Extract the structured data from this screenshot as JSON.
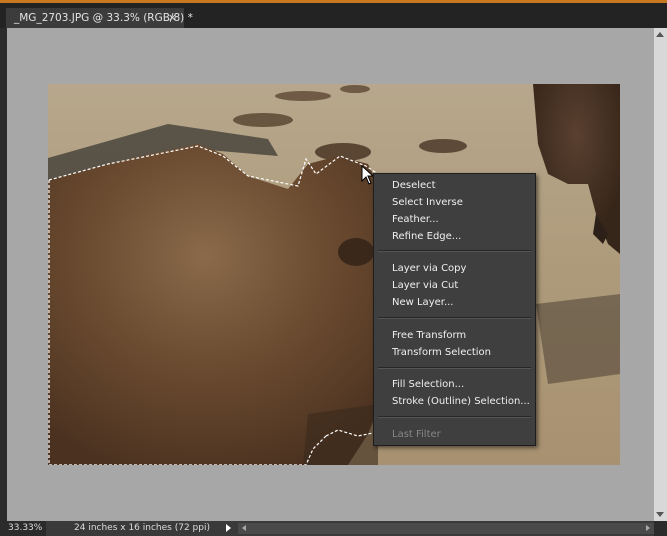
{
  "document_tab": {
    "title": "_MG_2703.JPG @ 33.3% (RGB/8) *",
    "close_glyph": "×"
  },
  "context_menu": {
    "groups": [
      [
        "Deselect",
        "Select Inverse",
        "Feather...",
        "Refine Edge..."
      ],
      [
        "Layer via Copy",
        "Layer via Cut",
        "New Layer..."
      ],
      [
        "Free Transform",
        "Transform Selection"
      ],
      [
        "Fill Selection...",
        "Stroke (Outline) Selection..."
      ],
      [
        "Last Filter"
      ]
    ],
    "disabled_items": [
      "Last Filter"
    ]
  },
  "status_bar": {
    "zoom": "33.33%",
    "document_size": "24 inches x 16 inches (72 ppi)"
  },
  "colors": {
    "accent": "#c8781e",
    "menu_bg": "#3f3f3f",
    "canvas_bg": "#a7a7a7"
  },
  "icons": [
    "close-icon",
    "arrow-cursor-icon",
    "status-menu-arrow-icon",
    "scroll-up-icon",
    "scroll-down-icon",
    "scroll-left-icon",
    "scroll-right-icon"
  ]
}
